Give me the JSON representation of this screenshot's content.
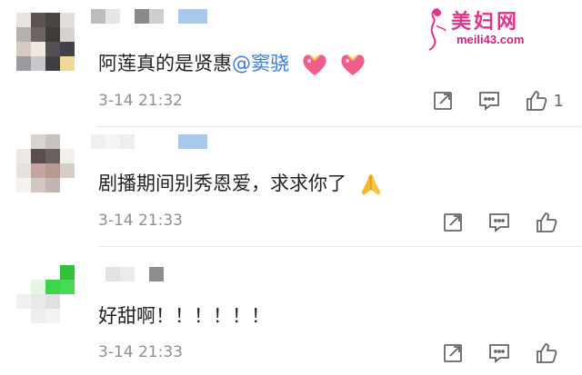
{
  "watermark": {
    "title": "美妇网",
    "url": "meili43.com"
  },
  "comments": [
    {
      "text_plain": "阿莲真的是贤惠",
      "mention": "@窦骁",
      "time": "3-14 21:32",
      "like_count": "1",
      "emoji": "heart-with-ribbon"
    },
    {
      "text_plain": "剧播期间别秀恩爱，求求你了",
      "emoji": "folded-hands",
      "time": "3-14 21:33",
      "like_count": ""
    },
    {
      "text_plain": "好甜啊！！！！！！",
      "time": "3-14 21:33",
      "like_count": ""
    }
  ],
  "icons": {
    "share": "share-icon",
    "reply": "comment-icon",
    "like": "thumbs-up-icon"
  },
  "colors": {
    "mention": "#3b7ad6",
    "time": "#8f8f8f",
    "icon": "#666666",
    "watermark": "#e0338a"
  }
}
